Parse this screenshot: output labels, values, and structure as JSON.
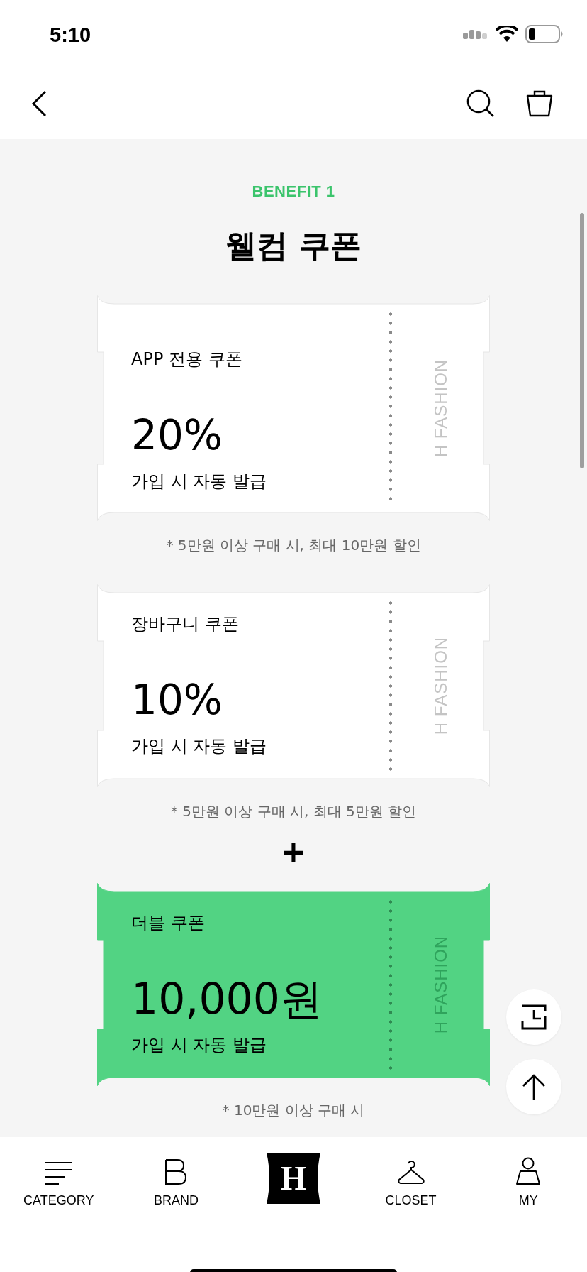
{
  "status_bar": {
    "time": "5:10"
  },
  "benefit": {
    "eyebrow": "BENEFIT 1",
    "title": "웰컴 쿠폰"
  },
  "coupons": [
    {
      "kind": "plain",
      "name": "APP 전용 쿠폰",
      "amount": "20%",
      "issue": "가입 시 자동 발급",
      "brand": "H FASHION",
      "note": "* 5만원 이상 구매 시, 최대 10만원 할인"
    },
    {
      "kind": "plain",
      "name": "장바구니 쿠폰",
      "amount": "10%",
      "issue": "가입 시 자동 발급",
      "brand": "H FASHION",
      "note": "* 5만원 이상 구매 시, 최대 5만원 할인"
    },
    {
      "kind": "highlight",
      "prefix": "+",
      "name": "더블 쿠폰",
      "amount": "10,000원",
      "issue": "가입 시 자동 발급",
      "brand": "H FASHION",
      "note": "* 10만원 이상 구매 시"
    }
  ],
  "bottom_nav": [
    {
      "kind": "category",
      "label": "CATEGORY"
    },
    {
      "kind": "brand",
      "label": "BRAND"
    },
    {
      "kind": "logo",
      "label": "H"
    },
    {
      "kind": "closet",
      "label": "CLOSET"
    },
    {
      "kind": "my",
      "label": "MY"
    }
  ]
}
